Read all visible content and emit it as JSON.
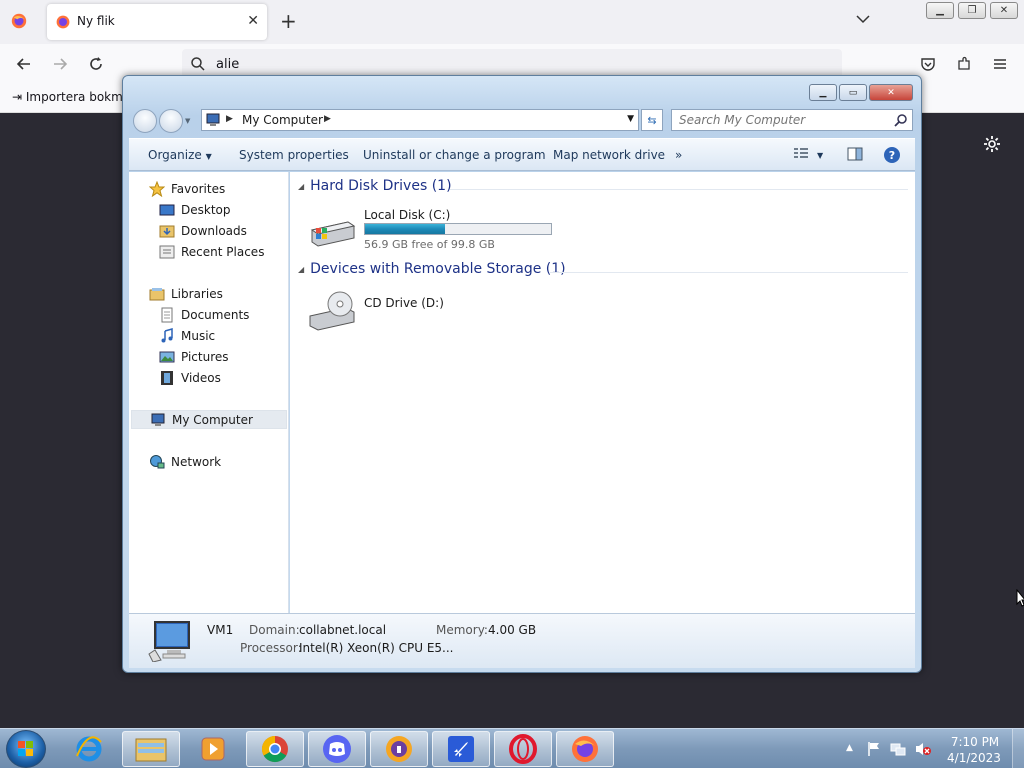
{
  "browser": {
    "tab_title": "Ny flik",
    "url_text": "alie",
    "bookmark_import": "Importera bokmä"
  },
  "explorer": {
    "address": "My Computer",
    "search_placeholder": "Search My Computer",
    "commands": {
      "organize": "Organize",
      "system_properties": "System properties",
      "uninstall": "Uninstall or change a program",
      "map_drive": "Map network drive",
      "more": "»"
    },
    "nav": {
      "favorites": "Favorites",
      "desktop": "Desktop",
      "downloads": "Downloads",
      "recent": "Recent Places",
      "libraries": "Libraries",
      "documents": "Documents",
      "music": "Music",
      "pictures": "Pictures",
      "videos": "Videos",
      "my_computer": "My Computer",
      "network": "Network"
    },
    "groups": {
      "hdd": "Hard Disk Drives (1)",
      "removable": "Devices with Removable Storage (1)"
    },
    "drives": {
      "c_name": "Local Disk (C:)",
      "c_free": "56.9 GB free of 99.8 GB",
      "c_used_fraction": 0.43,
      "d_name": "CD Drive (D:)"
    },
    "details": {
      "name": "VM1",
      "domain_label": "Domain:",
      "domain_value": "collabnet.local",
      "memory_label": "Memory:",
      "memory_value": "4.00 GB",
      "processor_label": "Processor:",
      "processor_value": "Intel(R) Xeon(R) CPU E5..."
    }
  },
  "taskbar": {
    "time": "7:10 PM",
    "date": "4/1/2023"
  },
  "colors": {
    "firefox_orange": "#ff7139",
    "explorer_link": "#1e3287",
    "capacity_fill": "#1d8ab8"
  }
}
